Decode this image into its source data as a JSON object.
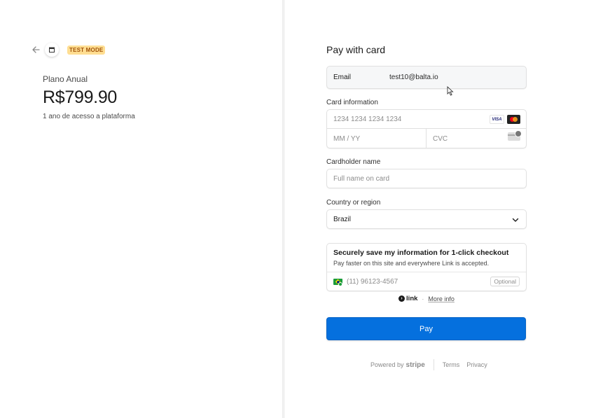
{
  "left_panel": {
    "back_icon": "arrow-left-icon",
    "merchant_icon": "store-icon",
    "test_mode_badge": "TEST MODE",
    "product_name": "Plano Anual",
    "price": "R$799.90",
    "product_description": "1 ano de acesso a plataforma"
  },
  "form": {
    "title": "Pay with card",
    "email": {
      "label": "Email",
      "value": "test10@balta.io"
    },
    "card_information": {
      "label": "Card information",
      "number_placeholder": "1234 1234 1234 1234",
      "expiry_placeholder": "MM / YY",
      "cvc_placeholder": "CVC",
      "brands": [
        "VISA",
        "mastercard-icon"
      ]
    },
    "cardholder": {
      "label": "Cardholder name",
      "placeholder": "Full name on card"
    },
    "country": {
      "label": "Country or region",
      "value": "Brazil"
    },
    "link": {
      "title": "Securely save my information for 1-click checkout",
      "subtitle": "Pay faster on this site and everywhere Link is accepted.",
      "phone_placeholder": "(11) 96123-4567",
      "optional_label": "Optional",
      "logo_text": "link",
      "separator": "·",
      "more_info": "More info"
    },
    "pay_button": "Pay"
  },
  "footer": {
    "powered_by": "Powered by",
    "stripe": "stripe",
    "terms": "Terms",
    "privacy": "Privacy"
  },
  "colors": {
    "primary": "#0570de",
    "badge_bg": "#ffde92",
    "badge_text": "#a1530a"
  }
}
